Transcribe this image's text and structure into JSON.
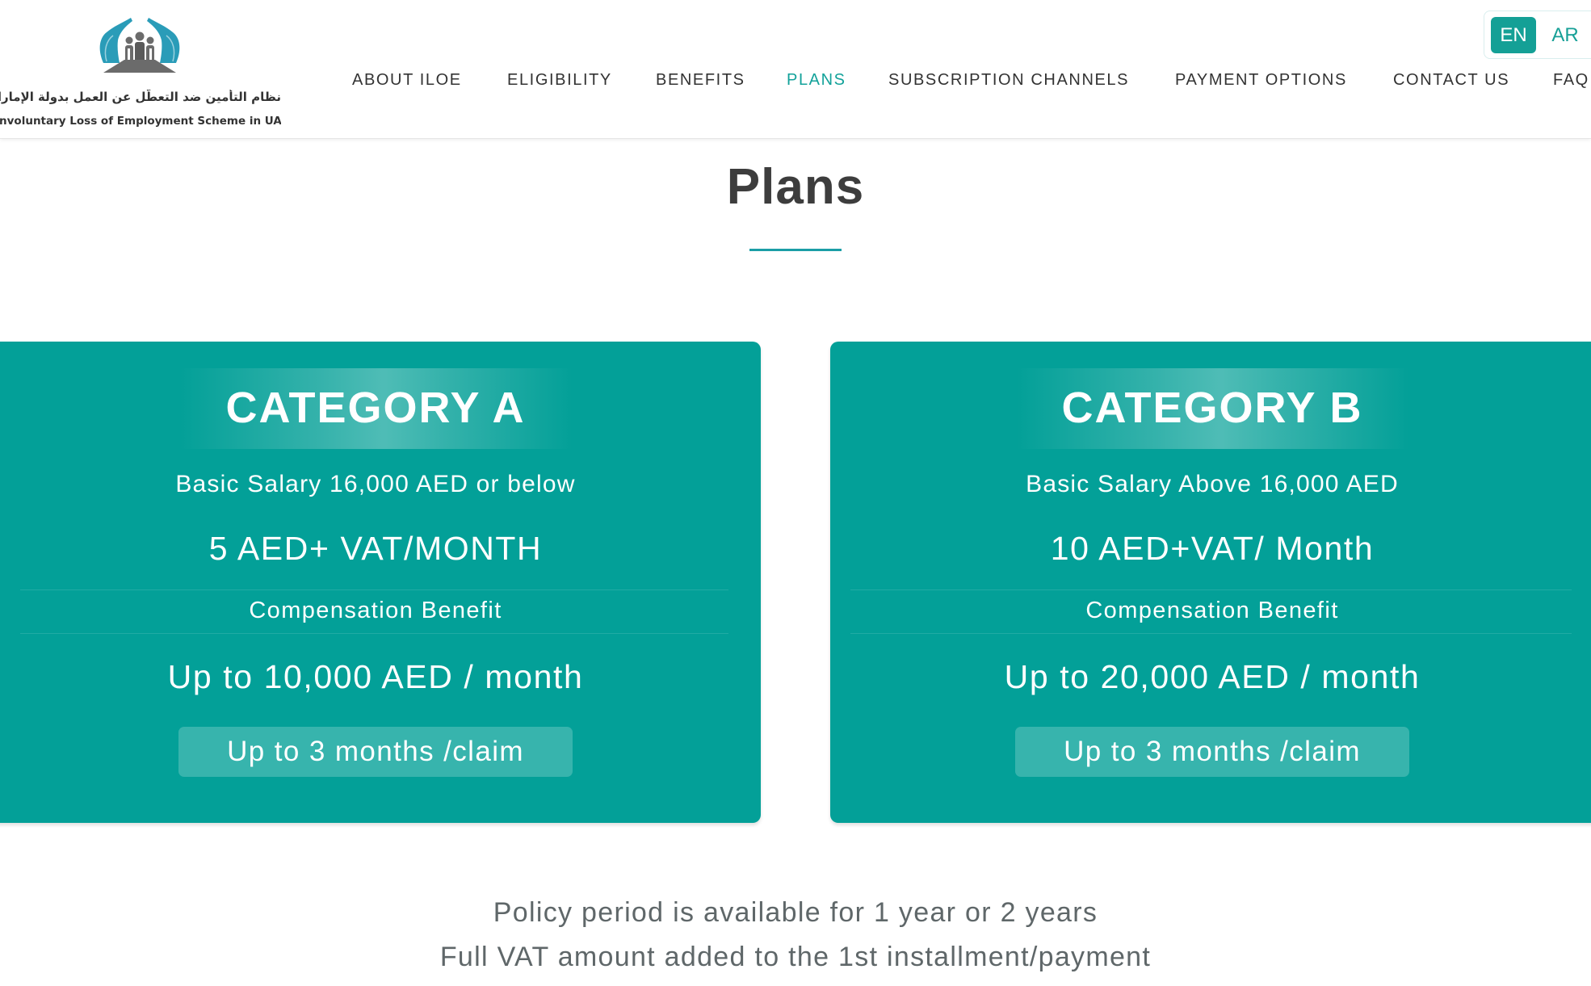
{
  "header": {
    "logo": {
      "icon": "hands-protecting-people-logo",
      "text_ar": "نظام التأمين ضد التعطّل عن العمل بدولة الإمارات",
      "text_en": "Involuntary Loss of Employment Scheme in UAE"
    },
    "nav": [
      {
        "label": "ABOUT ILOE",
        "active": false
      },
      {
        "label": "ELIGIBILITY",
        "active": false
      },
      {
        "label": "BENEFITS",
        "active": false
      },
      {
        "label": "PLANS",
        "active": true
      },
      {
        "label": "SUBSCRIPTION CHANNELS",
        "active": false
      },
      {
        "label": "PAYMENT OPTIONS",
        "active": false
      },
      {
        "label": "CONTACT US",
        "active": false
      },
      {
        "label": "FAQ",
        "active": false
      }
    ],
    "language": {
      "options": [
        "EN",
        "AR"
      ],
      "selected": "EN"
    }
  },
  "page": {
    "title": "Plans"
  },
  "plans": [
    {
      "category": "CATEGORY A",
      "salary": "Basic Salary 16,000 AED or below",
      "price": "5 AED+ VAT/MONTH",
      "benefit_label": "Compensation Benefit",
      "benefit_amount": "Up to 10,000 AED / month",
      "duration": "Up to 3 months /claim"
    },
    {
      "category": "CATEGORY B",
      "salary": "Basic Salary Above 16,000 AED",
      "price": "10 AED+VAT/ Month",
      "benefit_label": "Compensation Benefit",
      "benefit_amount": "Up to 20,000 AED / month",
      "duration": "Up to 3 months /claim"
    }
  ],
  "notes": [
    "Policy period is available for 1 year or 2 years",
    "Full VAT amount added to the 1st installment/payment"
  ],
  "colors": {
    "brand_teal": "#03a098",
    "pill_teal": "#37b4ad",
    "nav_active": "#13a29a",
    "title_text": "#3d3d3d",
    "note_text": "#5f6769",
    "logo_blue": "#2a9cb8",
    "logo_grey": "#6b6b6b"
  }
}
